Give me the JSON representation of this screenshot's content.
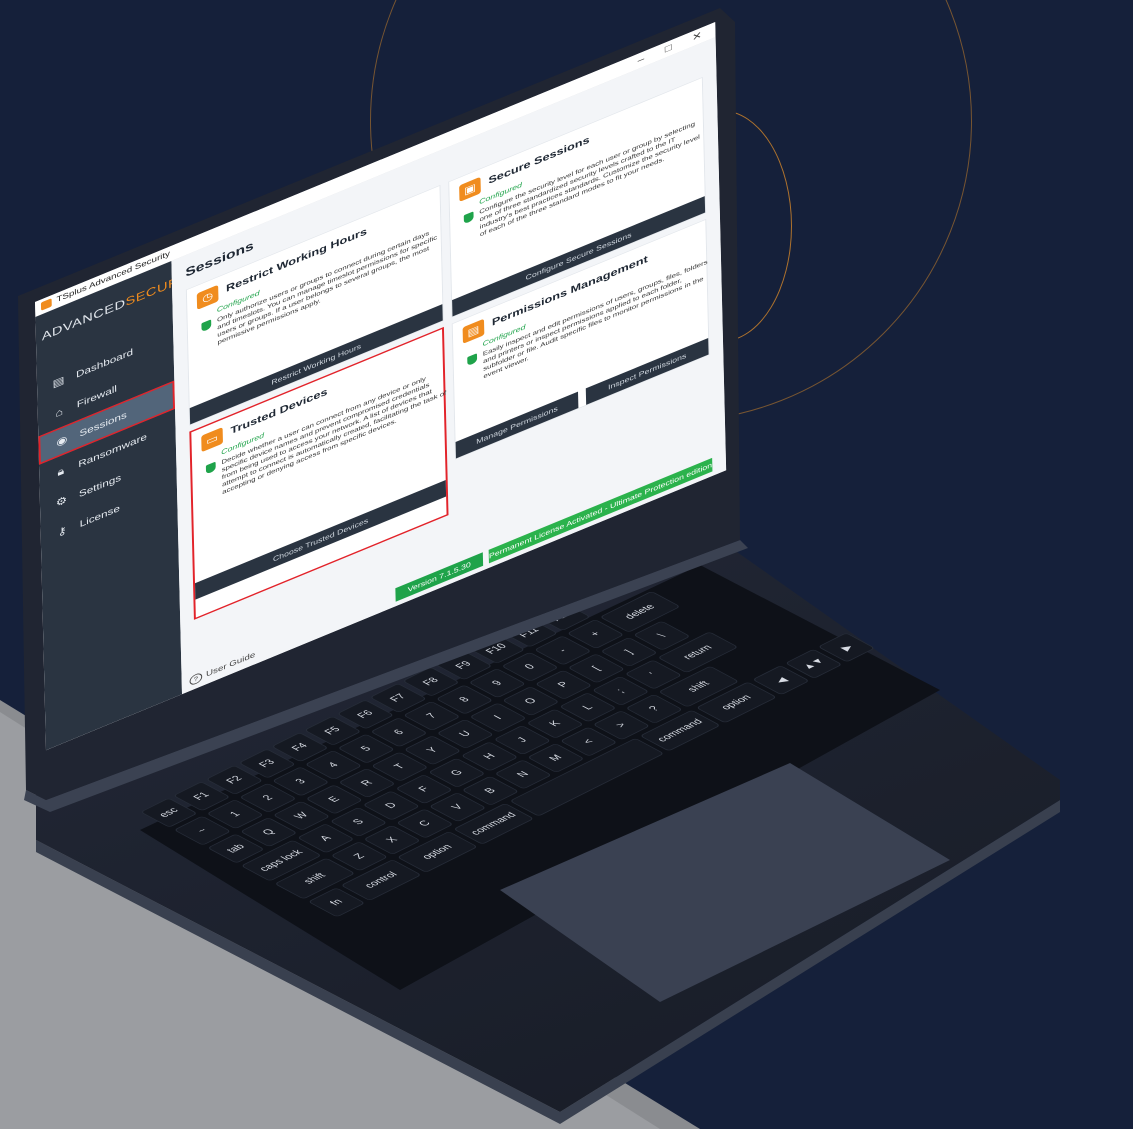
{
  "app": {
    "window_title": "TSplus Advanced Security",
    "brand_prefix": "ADVANCED",
    "brand_suffix": "SECURITY",
    "controls": {
      "minimize": "–",
      "maximize": "□",
      "close": "✕"
    }
  },
  "sidebar": {
    "items": [
      {
        "label": "Dashboard",
        "icon": "dashboard-icon"
      },
      {
        "label": "Firewall",
        "icon": "firewall-icon"
      },
      {
        "label": "Sessions",
        "icon": "sessions-icon",
        "active": true
      },
      {
        "label": "Ransomware",
        "icon": "lock-icon"
      },
      {
        "label": "Settings",
        "icon": "gear-icon"
      },
      {
        "label": "License",
        "icon": "key-icon"
      }
    ]
  },
  "main": {
    "title": "Sessions",
    "cards": [
      {
        "title": "Restrict Working Hours",
        "status": "Configured",
        "description": "Only authorize users or groups to connect during certain days and timeslots. You can manage timeslot permissions for specific users or groups. If a user belongs to several groups, the most permissive permissions apply.",
        "button": "Restrict Working Hours"
      },
      {
        "title": "Secure Sessions",
        "status": "Configured",
        "description": "Configure the security level for each user or group by selecting one of three standardized security levels crafted to the IT industry's best practices standards. Customize the security level of each of the three standard modes to fit your needs.",
        "button": "Configure Secure Sessions"
      },
      {
        "title": "Trusted Devices",
        "status": "Configured",
        "description": "Decide whether a user can connect from any device or only specific device names and prevent compromised credentials from being used to access your network. A list of devices that attempt to connect is automatically created, facilitating the task of accepting or denying access from specific devices.",
        "button": "Choose Trusted Devices"
      },
      {
        "title": "Permissions Management",
        "status": "Configured",
        "description": "Easily inspect and edit permissions of users, groups, files, folders and printers or inspect permissions applied to each folder, subfolder or file. Audit specific files to monitor permissions in the event viewer.",
        "button_left": "Manage Permissions",
        "button_right": "Inspect Permissions"
      }
    ]
  },
  "footer": {
    "user_guide": "User Guide",
    "version": "Version 7.1.5.30",
    "license": "Permanent License Activated - Ultimate Protection edition"
  },
  "keyboard": {
    "rows": [
      [
        "esc",
        "F1",
        "F2",
        "F3",
        "F4",
        "F5",
        "F6",
        "F7",
        "F8",
        "F9",
        "F10",
        "F11",
        "F12"
      ],
      [
        "~",
        "1",
        "2",
        "3",
        "4",
        "5",
        "6",
        "7",
        "8",
        "9",
        "0",
        "-",
        "+",
        "delete"
      ],
      [
        "tab",
        "Q",
        "W",
        "E",
        "R",
        "T",
        "Y",
        "U",
        "I",
        "O",
        "P",
        "[",
        "]",
        "\\"
      ],
      [
        "caps lock",
        "A",
        "S",
        "D",
        "F",
        "G",
        "H",
        "J",
        "K",
        "L",
        ";",
        "'",
        "return"
      ],
      [
        "shift",
        "Z",
        "X",
        "C",
        "V",
        "B",
        "N",
        "M",
        "<",
        ">",
        "?",
        "shift"
      ],
      [
        "fn",
        "control",
        "option",
        "command",
        "",
        "command",
        "option",
        "◀",
        "▲▼",
        "▶"
      ]
    ]
  },
  "colors": {
    "accent": "#f08c1e",
    "sidebar": "#2a3441",
    "success": "#1fa34a",
    "highlight": "#e2232a"
  }
}
